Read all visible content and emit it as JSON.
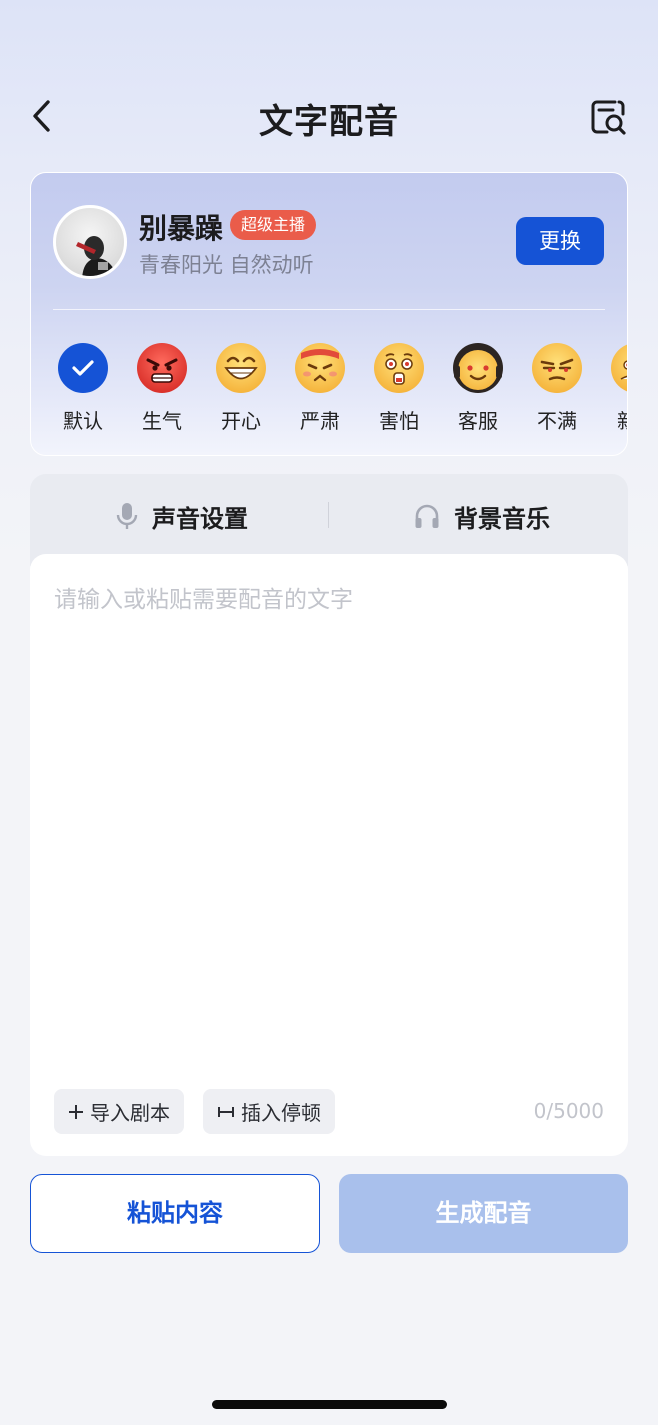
{
  "header": {
    "title": "文字配音",
    "back_icon": "chevron-left-icon",
    "search_icon": "document-search-icon"
  },
  "voice": {
    "name": "别暴躁",
    "badge": "超级主播",
    "description": "青春阳光 自然动听",
    "change_label": "更换"
  },
  "emotions": [
    {
      "label": "默认",
      "icon": "check-icon",
      "selected": true
    },
    {
      "label": "生气",
      "icon": "angry-face-icon",
      "selected": false
    },
    {
      "label": "开心",
      "icon": "grinning-face-icon",
      "selected": false
    },
    {
      "label": "严肃",
      "icon": "serious-face-icon",
      "selected": false
    },
    {
      "label": "害怕",
      "icon": "scared-face-icon",
      "selected": false
    },
    {
      "label": "客服",
      "icon": "headset-face-icon",
      "selected": false
    },
    {
      "label": "不满",
      "icon": "annoyed-face-icon",
      "selected": false
    },
    {
      "label": "新",
      "icon": "partial-face-icon",
      "selected": false
    }
  ],
  "tabs": [
    {
      "label": "声音设置",
      "icon": "microphone-icon"
    },
    {
      "label": "背景音乐",
      "icon": "headphones-icon"
    }
  ],
  "editor": {
    "placeholder": "请输入或粘贴需要配音的文字",
    "import_label": "导入剧本",
    "pause_label": "插入停顿",
    "counter": "0/5000"
  },
  "actions": {
    "paste_label": "粘贴内容",
    "generate_label": "生成配音"
  },
  "colors": {
    "primary": "#1553d6",
    "badge": "#ea5c4a",
    "disabled_button": "#a9c0ec"
  }
}
